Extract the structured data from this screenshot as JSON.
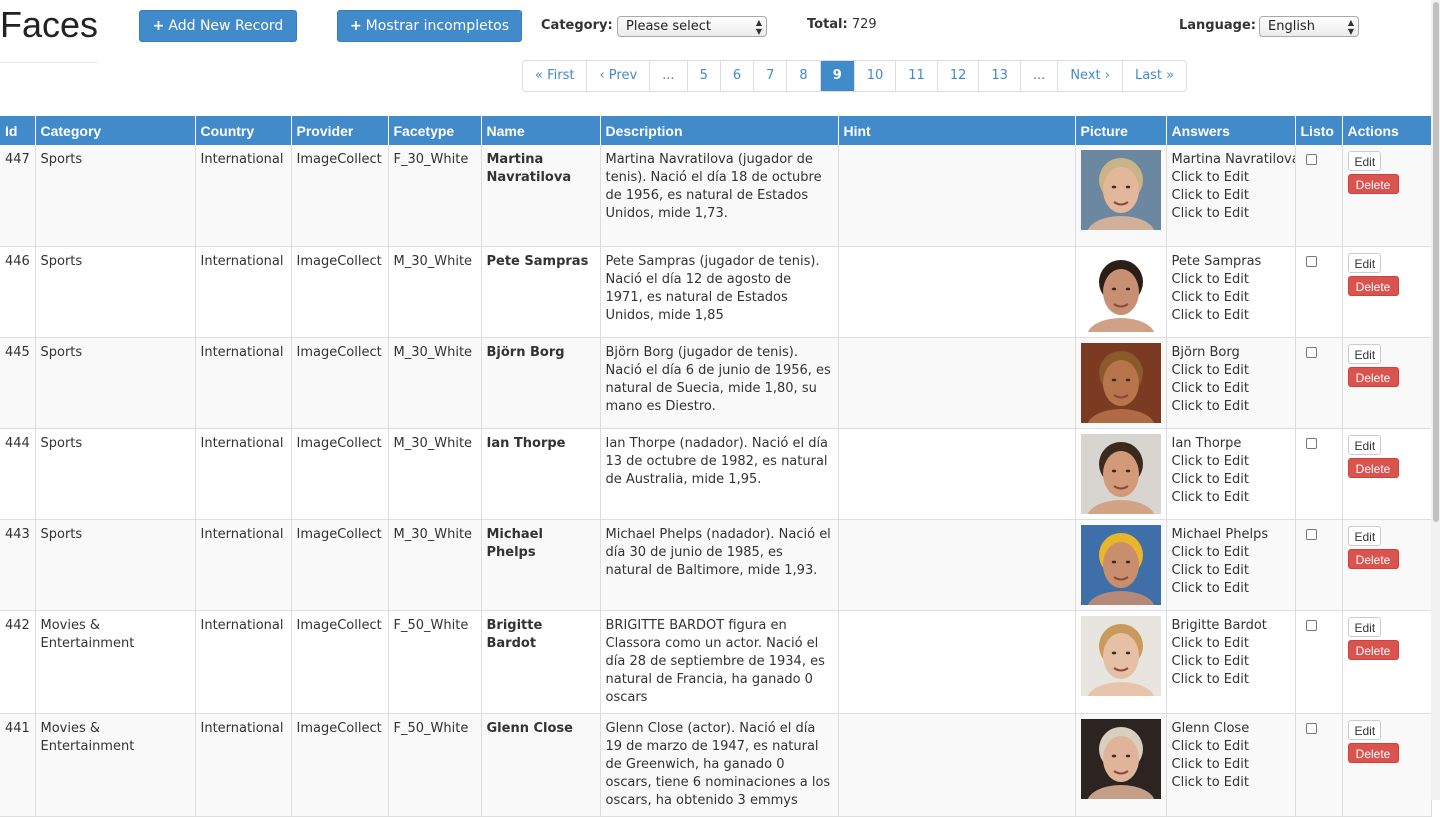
{
  "app": {
    "title": "Faces"
  },
  "toolbar": {
    "add_label": "Add New Record",
    "incomplete_label": "Mostrar incompletos",
    "category_label": "Category:",
    "category_value": "Please select",
    "total_label": "Total:",
    "total_value": "729",
    "language_label": "Language:",
    "language_value": "English"
  },
  "pagination": [
    {
      "label": "« First",
      "active": false
    },
    {
      "label": "‹ Prev",
      "active": false
    },
    {
      "label": "...",
      "active": false
    },
    {
      "label": "5",
      "active": false
    },
    {
      "label": "6",
      "active": false
    },
    {
      "label": "7",
      "active": false
    },
    {
      "label": "8",
      "active": false
    },
    {
      "label": "9",
      "active": true
    },
    {
      "label": "10",
      "active": false
    },
    {
      "label": "11",
      "active": false
    },
    {
      "label": "12",
      "active": false
    },
    {
      "label": "13",
      "active": false
    },
    {
      "label": "...",
      "active": false
    },
    {
      "label": "Next ›",
      "active": false
    },
    {
      "label": "Last »",
      "active": false
    }
  ],
  "table": {
    "columns": [
      "Id",
      "Category",
      "Country",
      "Provider",
      "Facetype",
      "Name",
      "Description",
      "Hint",
      "Picture",
      "Answers",
      "Listo",
      "Actions"
    ],
    "edit_label": "Edit",
    "delete_label": "Delete",
    "rows": [
      {
        "id": "447",
        "category": "Sports",
        "country": "International",
        "provider": "ImageCollect",
        "facetype": "F_30_White",
        "name": "Martina Navratilova",
        "description": "Martina Navratilova (jugador de tenis). Nació el día 18 de octubre de 1956, es natural de Estados Unidos, mide 1,73.",
        "hint": "",
        "answers": [
          "Martina Navratilova",
          "Click to Edit",
          "Click to Edit",
          "Click to Edit"
        ],
        "face": {
          "bg": "#6c87a0",
          "skin": "#e3b79a",
          "hair": "#c9b48a"
        }
      },
      {
        "id": "446",
        "category": "Sports",
        "country": "International",
        "provider": "ImageCollect",
        "facetype": "M_30_White",
        "name": "Pete Sampras",
        "description": "Pete Sampras (jugador de tenis). Nació el día 12 de agosto de 1971, es natural de Estados Unidos, mide 1,85",
        "hint": "",
        "answers": [
          "Pete Sampras",
          "Click to Edit",
          "Click to Edit",
          "Click to Edit"
        ],
        "face": {
          "bg": "#ffffff",
          "skin": "#c89072",
          "hair": "#2a1e16"
        }
      },
      {
        "id": "445",
        "category": "Sports",
        "country": "International",
        "provider": "ImageCollect",
        "facetype": "M_30_White",
        "name": "Björn Borg",
        "description": "Björn Borg (jugador de tenis). Nació el día 6 de junio de 1956, es natural de Suecia, mide 1,80, su mano es Diestro.",
        "hint": "",
        "answers": [
          "Björn Borg",
          "Click to Edit",
          "Click to Edit",
          "Click to Edit"
        ],
        "face": {
          "bg": "#7a3b22",
          "skin": "#b8744a",
          "hair": "#8a5a2a"
        }
      },
      {
        "id": "444",
        "category": "Sports",
        "country": "International",
        "provider": "ImageCollect",
        "facetype": "M_30_White",
        "name": "Ian Thorpe",
        "description": "Ian Thorpe (nadador). Nació el día 13 de octubre de 1982, es natural de Australia, mide 1,95.",
        "hint": "",
        "answers": [
          "Ian Thorpe",
          "Click to Edit",
          "Click to Edit",
          "Click to Edit"
        ],
        "face": {
          "bg": "#d8d4cf",
          "skin": "#d29a78",
          "hair": "#3a2a1e"
        }
      },
      {
        "id": "443",
        "category": "Sports",
        "country": "International",
        "provider": "ImageCollect",
        "facetype": "M_30_White",
        "name": "Michael Phelps",
        "description": "Michael Phelps (nadador). Nació el día 30 de junio de 1985, es natural de Baltimore, mide 1,93.",
        "hint": "",
        "answers": [
          "Michael Phelps",
          "Click to Edit",
          "Click to Edit",
          "Click to Edit"
        ],
        "face": {
          "bg": "#3f6fa8",
          "skin": "#c98e6e",
          "hair": "#e9b52a"
        }
      },
      {
        "id": "442",
        "category": "Movies & Entertainment",
        "country": "International",
        "provider": "ImageCollect",
        "facetype": "F_50_White",
        "name": "Brigitte Bardot",
        "description": "BRIGITTE BARDOT figura en Classora como un actor. Nació el día 28 de septiembre de 1934, es natural de Francia, ha ganado 0 oscars",
        "hint": "",
        "answers": [
          "Brigitte Bardot",
          "Click to Edit",
          "Click to Edit",
          "Click to Edit"
        ],
        "face": {
          "bg": "#e8e4df",
          "skin": "#e6c0a4",
          "hair": "#c99a5c"
        }
      },
      {
        "id": "441",
        "category": "Movies & Entertainment",
        "country": "International",
        "provider": "ImageCollect",
        "facetype": "F_50_White",
        "name": "Glenn Close",
        "description": "Glenn Close (actor). Nació el día 19 de marzo de 1947, es natural de Greenwich, ha ganado 0 oscars, tiene 6 nominaciones a los oscars, ha obtenido 3 emmys",
        "hint": "",
        "answers": [
          "Glenn Close",
          "Click to Edit",
          "Click to Edit",
          "Click to Edit"
        ],
        "face": {
          "bg": "#2c2420",
          "skin": "#e0b49a",
          "hair": "#d8cfc0"
        }
      }
    ]
  }
}
